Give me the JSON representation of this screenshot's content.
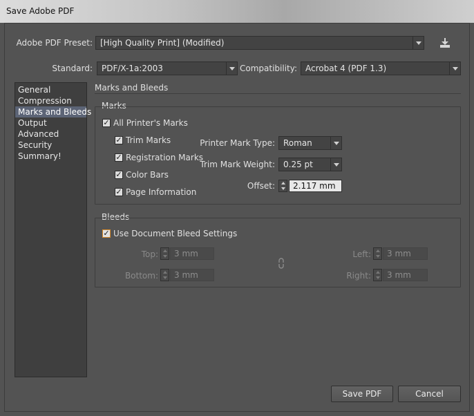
{
  "window": {
    "title": "Save Adobe PDF"
  },
  "preset": {
    "label": "Adobe PDF Preset:",
    "value": "[High Quality Print] (Modified)"
  },
  "standard": {
    "label": "Standard:",
    "value": "PDF/X-1a:2003"
  },
  "compatibility": {
    "label": "Compatibility:",
    "value": "Acrobat 4 (PDF 1.3)"
  },
  "nav": {
    "items": [
      {
        "label": "General"
      },
      {
        "label": "Compression"
      },
      {
        "label": "Marks and Bleeds"
      },
      {
        "label": "Output"
      },
      {
        "label": "Advanced"
      },
      {
        "label": "Security"
      },
      {
        "label": "Summary!"
      }
    ],
    "selected": "Marks and Bleeds"
  },
  "section": {
    "title": "Marks and Bleeds"
  },
  "marks": {
    "title": "Marks",
    "all_printers_marks": "All Printer's Marks",
    "trim_marks": "Trim Marks",
    "registration_marks": "Registration Marks",
    "color_bars": "Color Bars",
    "page_information": "Page Information",
    "printer_mark_type_label": "Printer Mark Type:",
    "printer_mark_type_value": "Roman",
    "trim_mark_weight_label": "Trim Mark Weight:",
    "trim_mark_weight_value": "0.25 pt",
    "offset_label": "Offset:",
    "offset_value": "2.117 mm"
  },
  "bleeds": {
    "title": "Bleeds",
    "use_document_bleed": "Use Document Bleed Settings",
    "top_label": "Top:",
    "top_value": "3 mm",
    "bottom_label": "Bottom:",
    "bottom_value": "3 mm",
    "left_label": "Left:",
    "left_value": "3 mm",
    "right_label": "Right:",
    "right_value": "3 mm"
  },
  "buttons": {
    "save": "Save PDF",
    "cancel": "Cancel"
  },
  "icons": {
    "save_preset": "save-preset-icon",
    "link": "chain-link-icon"
  },
  "colors": {
    "dialog_bg": "#535353",
    "nav_selected": "#5c6476",
    "checkbox_focus": "#d88a2a"
  }
}
